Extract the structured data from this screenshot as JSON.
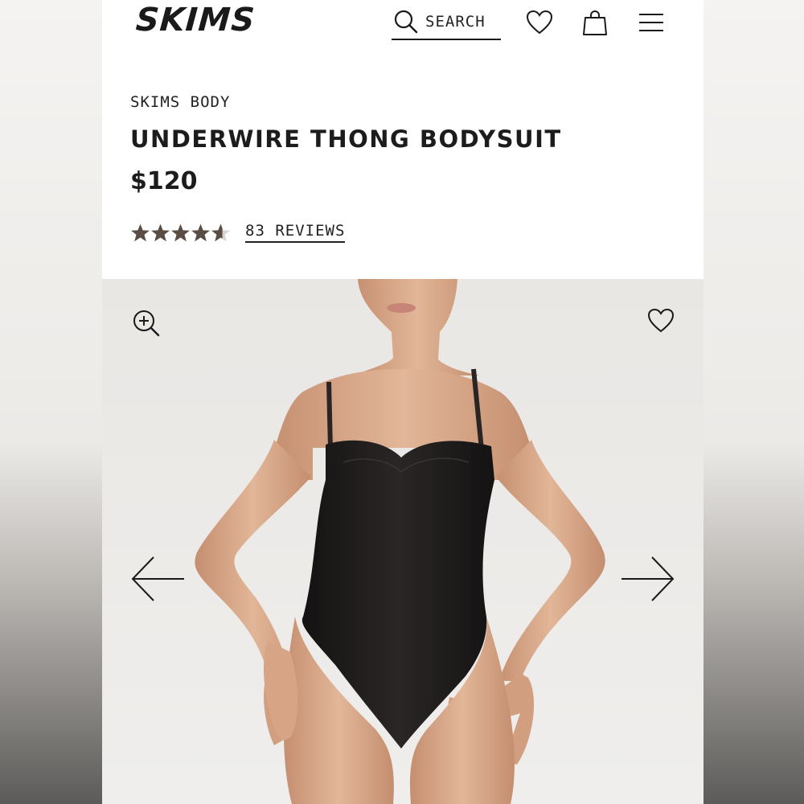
{
  "header": {
    "logo": "SKIMS",
    "search_label": "SEARCH",
    "icons": [
      "search-icon",
      "heart-icon",
      "shopping-bag-icon",
      "menu-icon"
    ]
  },
  "product": {
    "brand": "SKIMS BODY",
    "title": "UNDERWIRE THONG BODYSUIT",
    "price": "$120",
    "rating": 4.5,
    "rating_max": 5,
    "reviews_label": "83 REVIEWS"
  },
  "gallery": {
    "icons": [
      "zoom-in-icon",
      "heart-icon",
      "arrow-left-icon",
      "arrow-right-icon"
    ]
  },
  "colors": {
    "text": "#1c1c1c",
    "star": "#5a4d44",
    "garment": "#1d1a1a",
    "skin": "#d8a88a",
    "gallery_bg": "#eceae7"
  }
}
